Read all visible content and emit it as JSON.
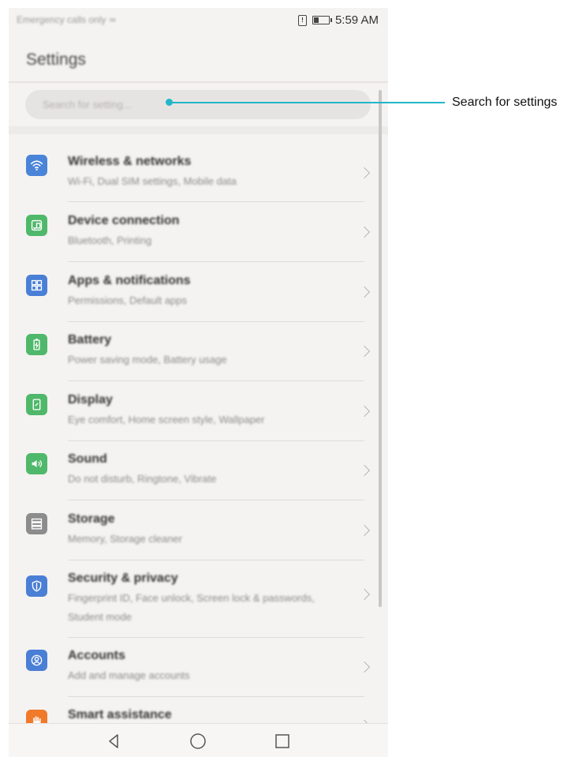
{
  "status_bar": {
    "carrier": "Emergency calls only",
    "time": "5:59 AM"
  },
  "page_title": "Settings",
  "search": {
    "placeholder": "Search for setting..."
  },
  "items": [
    {
      "title": "Wireless & networks",
      "subtitle": "Wi-Fi, Dual SIM settings, Mobile data",
      "icon": "wifi-icon",
      "color": "#4a84d9"
    },
    {
      "title": "Device connection",
      "subtitle": "Bluetooth, Printing",
      "icon": "device-connection-icon",
      "color": "#4fb86a"
    },
    {
      "title": "Apps & notifications",
      "subtitle": "Permissions, Default apps",
      "icon": "apps-icon",
      "color": "#4a7fd6"
    },
    {
      "title": "Battery",
      "subtitle": "Power saving mode, Battery usage",
      "icon": "battery-icon",
      "color": "#4fb86a"
    },
    {
      "title": "Display",
      "subtitle": "Eye comfort, Home screen style, Wallpaper",
      "icon": "display-icon",
      "color": "#4fb86a"
    },
    {
      "title": "Sound",
      "subtitle": "Do not disturb, Ringtone, Vibrate",
      "icon": "sound-icon",
      "color": "#4fb86a"
    },
    {
      "title": "Storage",
      "subtitle": "Memory, Storage cleaner",
      "icon": "storage-icon",
      "color": "#8c8c8c"
    },
    {
      "title": "Security & privacy",
      "subtitle": "Fingerprint ID, Face unlock, Screen lock & passwords, Student mode",
      "icon": "shield-icon",
      "color": "#4a7fd6"
    },
    {
      "title": "Accounts",
      "subtitle": "Add and manage accounts",
      "icon": "account-icon",
      "color": "#4a7fd6"
    },
    {
      "title": "Smart assistance",
      "subtitle": "",
      "icon": "hand-icon",
      "color": "#f07a2a"
    }
  ],
  "annotation": {
    "label": "Search for settings",
    "color": "#22b6c9"
  }
}
